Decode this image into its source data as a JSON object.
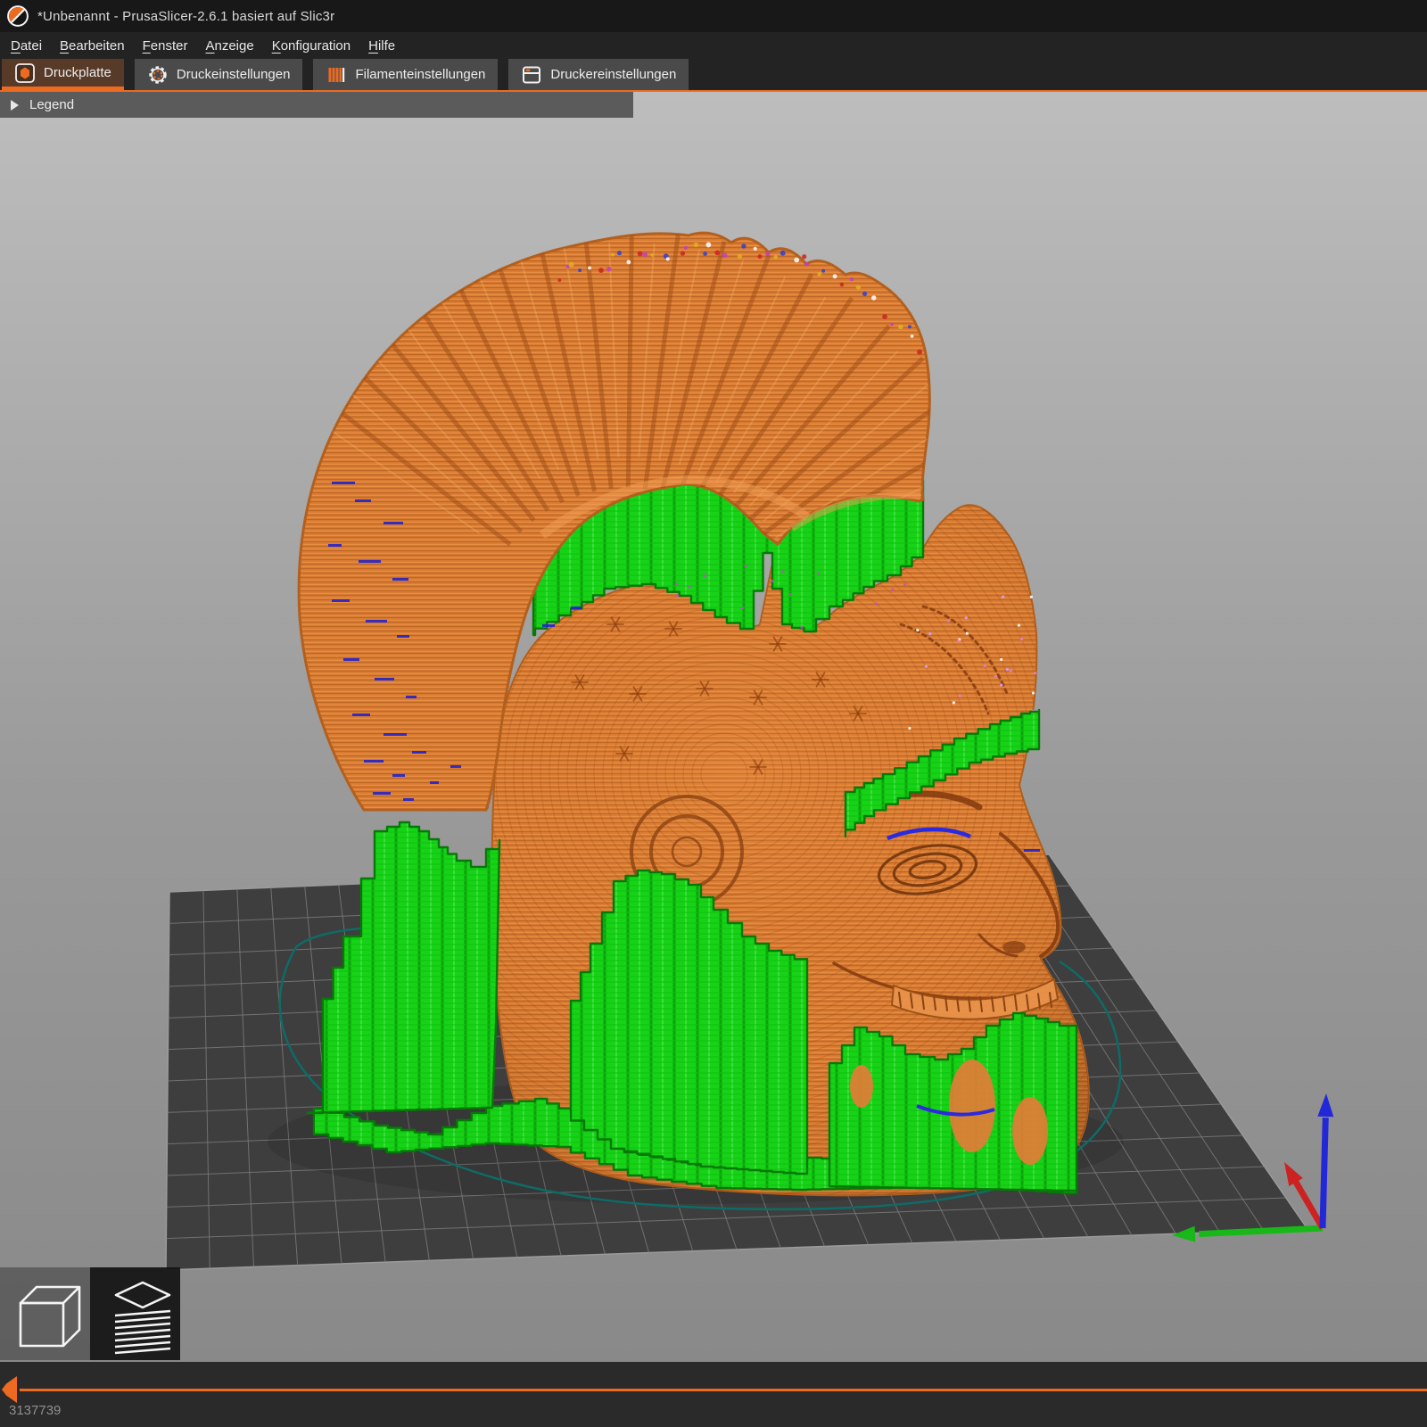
{
  "window": {
    "title": "*Unbenannt - PrusaSlicer-2.6.1 basiert auf Slic3r"
  },
  "menu": {
    "items": [
      {
        "key": "D",
        "rest": "atei"
      },
      {
        "key": "B",
        "rest": "earbeiten"
      },
      {
        "key": "F",
        "rest": "enster"
      },
      {
        "key": "A",
        "rest": "nzeige"
      },
      {
        "key": "K",
        "rest": "onfiguration"
      },
      {
        "key": "H",
        "rest": "ilfe"
      }
    ]
  },
  "tabs": {
    "items": [
      {
        "label": "Druckplatte",
        "icon": "print-plate-icon",
        "active": true
      },
      {
        "label": "Druckeinstellungen",
        "icon": "gear-icon",
        "active": false
      },
      {
        "label": "Filamenteinstellungen",
        "icon": "filament-icon",
        "active": false
      },
      {
        "label": "Druckereinstellungen",
        "icon": "printer-icon",
        "active": false
      }
    ]
  },
  "legend": {
    "label": "Legend",
    "collapsed": true
  },
  "viewport": {
    "content": "Sliced skull model with mohawk crest, orange extrusions with green support material on dark build plate"
  },
  "view_toolbar": {
    "buttons": [
      {
        "name": "3d-editor-view",
        "icon": "cube-icon",
        "active": false
      },
      {
        "name": "preview-view",
        "icon": "layers-icon",
        "active": true
      }
    ]
  },
  "layer_slider": {
    "value": "3137739"
  },
  "colors": {
    "accent": "#ED6B21",
    "model": "#DC7E35",
    "model_line": "#BE6826",
    "model_dark": "#B05F1D",
    "support": "#17D317",
    "support_line": "#0CA30C",
    "support_dark": "#067A06",
    "bridge_blue": "#2525CC",
    "plate": "#3E3E3E",
    "plate_grid": "#7E7E7E",
    "skirt": "#0E6B66",
    "axis_x": "#CC2222",
    "axis_y": "#18B818",
    "axis_z": "#2228D8"
  }
}
